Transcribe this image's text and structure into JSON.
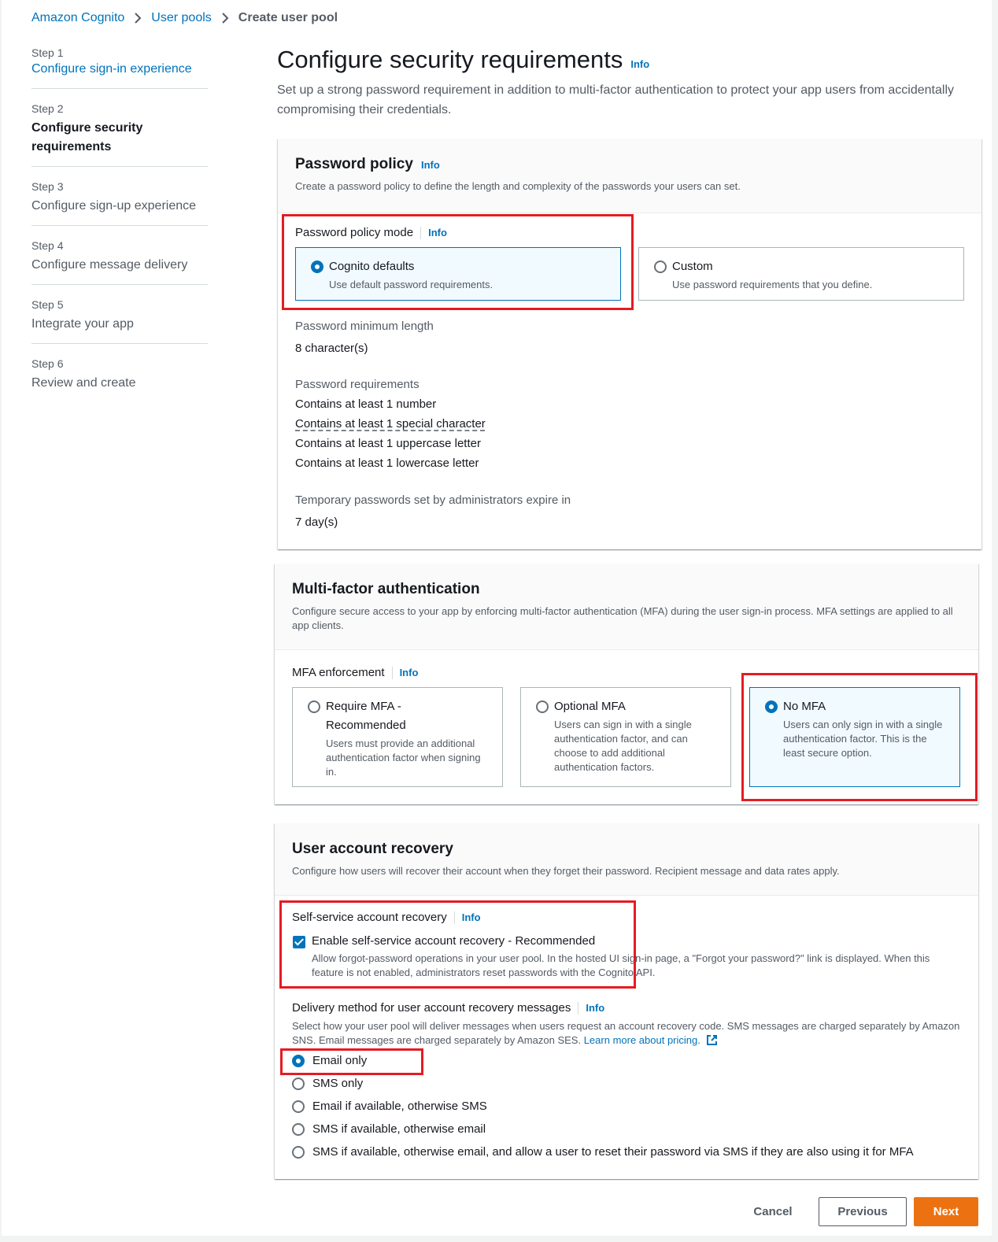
{
  "breadcrumb": {
    "items": [
      {
        "label": "Amazon Cognito"
      },
      {
        "label": "User pools"
      },
      {
        "label": "Create user pool"
      }
    ]
  },
  "steps": [
    {
      "num": "Step 1",
      "title": "Configure sign-in experience",
      "state": "link"
    },
    {
      "num": "Step 2",
      "title": "Configure security requirements",
      "state": "active"
    },
    {
      "num": "Step 3",
      "title": "Configure sign-up experience",
      "state": "pending"
    },
    {
      "num": "Step 4",
      "title": "Configure message delivery",
      "state": "pending"
    },
    {
      "num": "Step 5",
      "title": "Integrate your app",
      "state": "pending"
    },
    {
      "num": "Step 6",
      "title": "Review and create",
      "state": "pending"
    }
  ],
  "page": {
    "title": "Configure security requirements",
    "info": "Info",
    "description": "Set up a strong password requirement in addition to multi-factor authentication to protect your app users from accidentally compromising their credentials."
  },
  "password_policy": {
    "title": "Password policy",
    "info": "Info",
    "description": "Create a password policy to define the length and complexity of the passwords your users can set.",
    "mode_label": "Password policy mode",
    "mode_info": "Info",
    "options": [
      {
        "title": "Cognito defaults",
        "desc": "Use default password requirements.",
        "selected": true
      },
      {
        "title": "Custom",
        "desc": "Use password requirements that you define.",
        "selected": false
      }
    ],
    "min_length_label": "Password minimum length",
    "min_length_value": "8 character(s)",
    "requirements_label": "Password requirements",
    "requirements": [
      "Contains at least 1 number",
      "Contains at least 1 special character",
      "Contains at least 1 uppercase letter",
      "Contains at least 1 lowercase letter"
    ],
    "temp_label": "Temporary passwords set by administrators expire in",
    "temp_value": "7 day(s)"
  },
  "mfa": {
    "title": "Multi-factor authentication",
    "description": "Configure secure access to your app by enforcing multi-factor authentication (MFA) during the user sign-in process. MFA settings are applied to all app clients.",
    "enforcement_label": "MFA enforcement",
    "enforcement_info": "Info",
    "options": [
      {
        "title": "Require MFA - Recommended",
        "desc": "Users must provide an additional authentication factor when signing in.",
        "selected": false
      },
      {
        "title": "Optional MFA",
        "desc": "Users can sign in with a single authentication factor, and can choose to add additional authentication factors.",
        "selected": false
      },
      {
        "title": "No MFA",
        "desc": "Users can only sign in with a single authentication factor. This is the least secure option.",
        "selected": true
      }
    ]
  },
  "recovery": {
    "title": "User account recovery",
    "description": "Configure how users will recover their account when they forget their password. Recipient message and data rates apply.",
    "self_service_label": "Self-service account recovery",
    "self_service_info": "Info",
    "checkbox_label": "Enable self-service account recovery - Recommended",
    "checkbox_desc": "Allow forgot-password operations in your user pool. In the hosted UI sign-in page, a \"Forgot your password?\" link is displayed. When this feature is not enabled, administrators reset passwords with the Cognito API.",
    "checked": true,
    "delivery_label": "Delivery method for user account recovery messages",
    "delivery_info": "Info",
    "delivery_desc": "Select how your user pool will deliver messages when users request an account recovery code. SMS messages are charged separately by Amazon SNS. Email messages are charged separately by Amazon SES.",
    "learn_more": "Learn more about pricing.",
    "methods": [
      {
        "label": "Email only",
        "selected": true
      },
      {
        "label": "SMS only",
        "selected": false
      },
      {
        "label": "Email if available, otherwise SMS",
        "selected": false
      },
      {
        "label": "SMS if available, otherwise email",
        "selected": false
      },
      {
        "label": "SMS if available, otherwise email, and allow a user to reset their password via SMS if they are also using it for MFA",
        "selected": false
      }
    ]
  },
  "footer": {
    "cancel": "Cancel",
    "previous": "Previous",
    "next": "Next"
  },
  "colors": {
    "link": "#0073bb",
    "primary_button": "#ec7211",
    "annotation": "#e41c23"
  }
}
